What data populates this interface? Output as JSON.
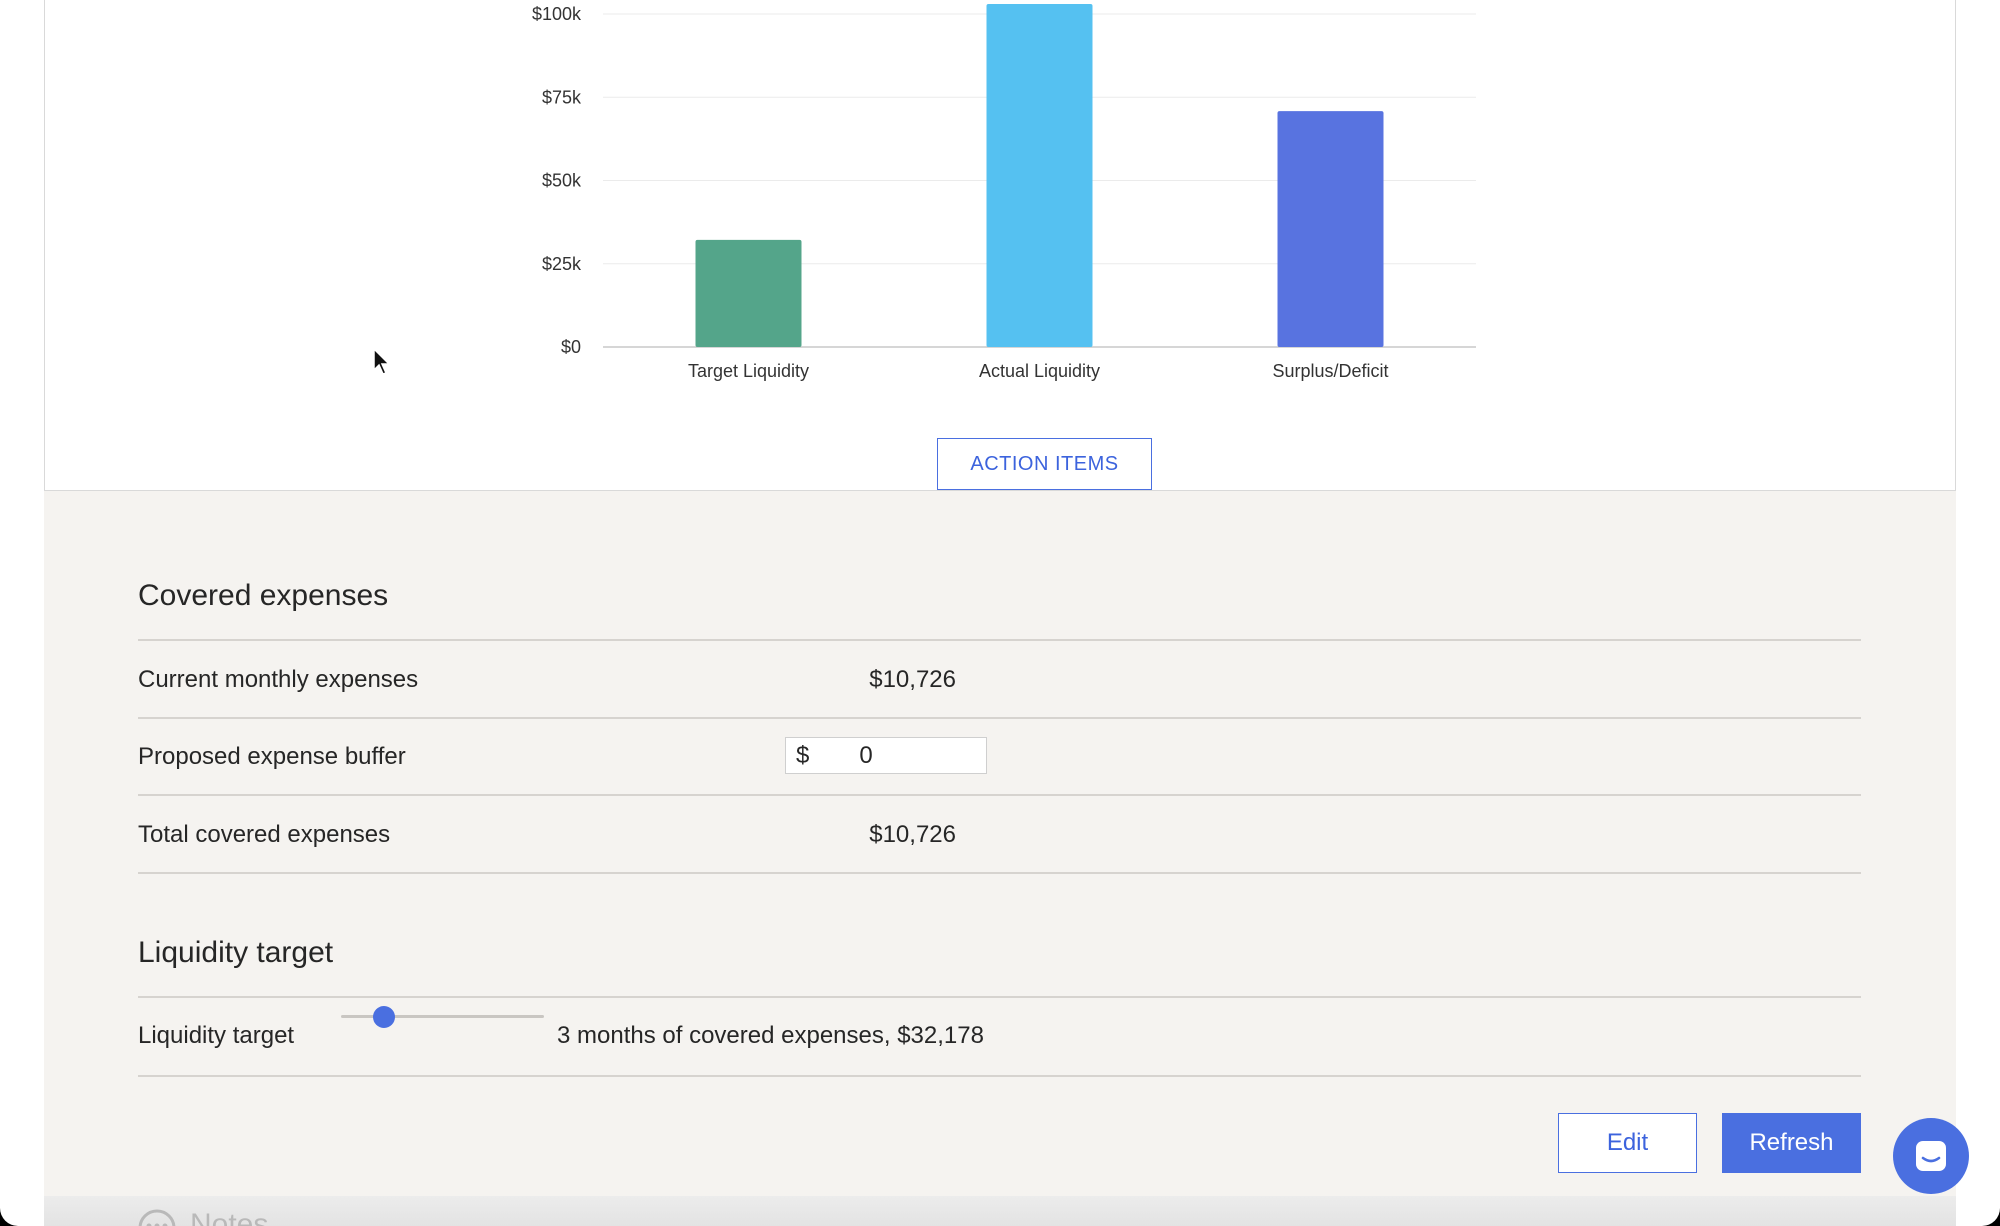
{
  "chart_data": {
    "type": "bar",
    "categories": [
      "Target Liquidity",
      "Actual Liquidity",
      "Surplus/Deficit"
    ],
    "values": [
      32178,
      103000,
      70822
    ],
    "colors": [
      "#54a58a",
      "#55c1f1",
      "#5873e0"
    ],
    "ylim": [
      0,
      100000
    ],
    "yticks": [
      0,
      25000,
      50000,
      75000,
      100000
    ],
    "ytick_labels": [
      "$0",
      "$25k",
      "$50k",
      "$75k",
      "$100k"
    ],
    "grid": true
  },
  "action_items_label": "ACTION ITEMS",
  "covered": {
    "title": "Covered expenses",
    "current_label": "Current monthly expenses",
    "current_value": "$10,726",
    "buffer_label": "Proposed expense buffer",
    "buffer_currency": "$",
    "buffer_value": "0",
    "total_label": "Total covered expenses",
    "total_value": "$10,726"
  },
  "liquidity": {
    "title": "Liquidity target",
    "row_label": "Liquidity target",
    "slider_value_months": 3,
    "slider_text": "3 months of covered expenses, $32,178"
  },
  "buttons": {
    "edit": "Edit",
    "refresh": "Refresh"
  },
  "notes_label": "Notes",
  "icons": [
    "cursor-arrow-icon",
    "chat-icon",
    "notes-icon"
  ]
}
